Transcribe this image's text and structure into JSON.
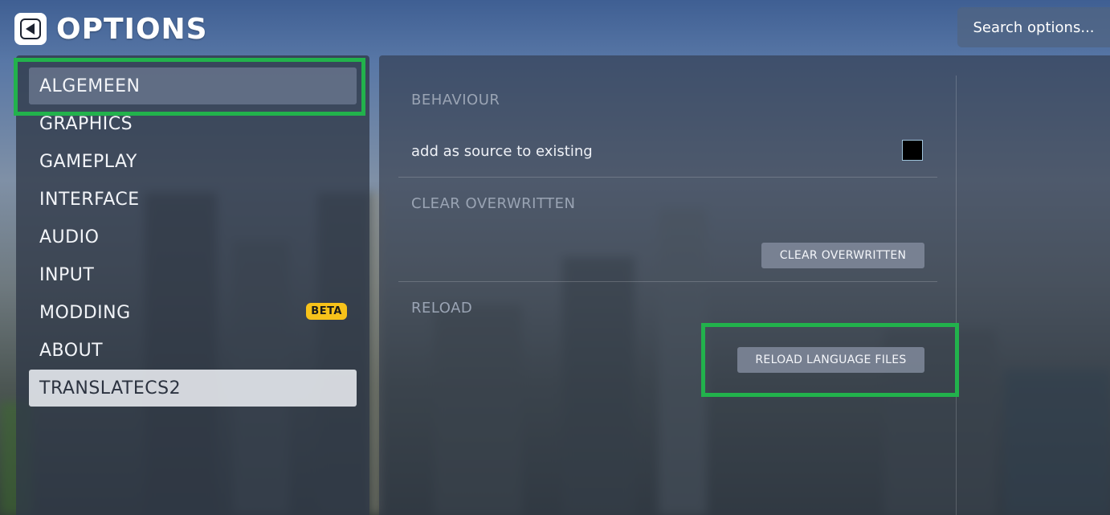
{
  "header": {
    "title": "OPTIONS",
    "search_placeholder": "Search options..."
  },
  "sidebar": {
    "items": [
      {
        "label": "ALGEMEEN",
        "state": "active"
      },
      {
        "label": "GRAPHICS"
      },
      {
        "label": "GAMEPLAY"
      },
      {
        "label": "INTERFACE"
      },
      {
        "label": "AUDIO"
      },
      {
        "label": "INPUT"
      },
      {
        "label": "MODDING",
        "badge": "BETA"
      },
      {
        "label": "ABOUT"
      },
      {
        "label": "TRANSLATECS2",
        "state": "selected"
      }
    ]
  },
  "panel": {
    "sections": [
      {
        "title": "BEHAVIOUR",
        "option_label": "add as source to existing"
      },
      {
        "title": "CLEAR OVERWRITTEN",
        "button_label": "CLEAR OVERWRITTEN"
      },
      {
        "title": "RELOAD",
        "button_label": "RELOAD LANGUAGE FILES"
      }
    ]
  },
  "colors": {
    "highlight": "#22b24c",
    "beta_badge": "#f7c21a"
  },
  "icons": {
    "back": "back-arrow-icon"
  }
}
